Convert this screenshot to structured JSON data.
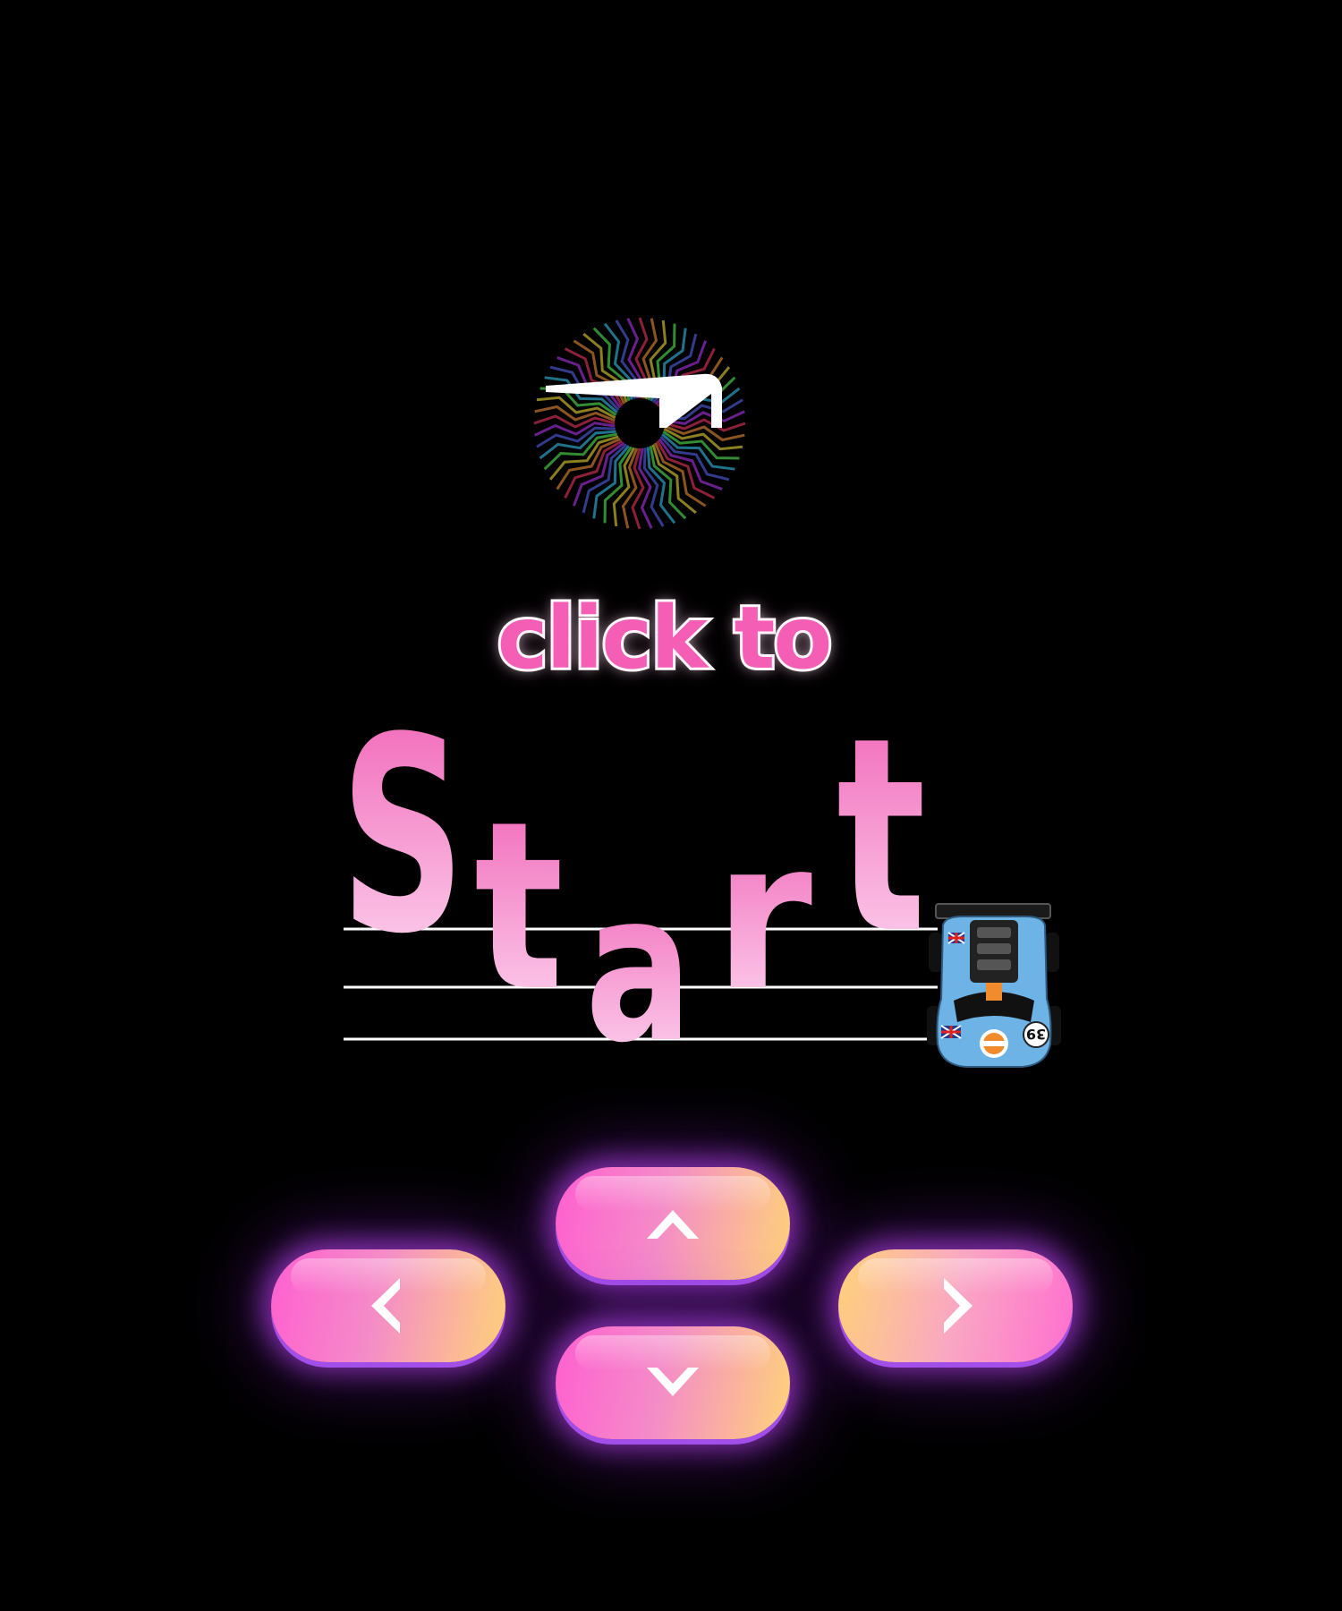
{
  "title": {
    "line1": "click to",
    "line2": "Start"
  },
  "logo": {
    "icon": "spinning-logo-icon",
    "colors": [
      "#ff3b6b",
      "#ff9a3b",
      "#ffe83b",
      "#5bff5b",
      "#3bd0ff",
      "#5b6bff",
      "#c03bff"
    ]
  },
  "car": {
    "icon": "race-car-icon",
    "number": "39",
    "body_color": "#6eb3e6"
  },
  "controls": {
    "up": {
      "icon": "chevron-up-icon"
    },
    "down": {
      "icon": "chevron-down-icon"
    },
    "left": {
      "icon": "chevron-left-icon"
    },
    "right": {
      "icon": "chevron-right-icon"
    }
  },
  "colors": {
    "background": "#000000",
    "accent_pink": "#f45fb5",
    "pad_glow": "#c64aff",
    "pad_gold": "#ffd27a"
  }
}
